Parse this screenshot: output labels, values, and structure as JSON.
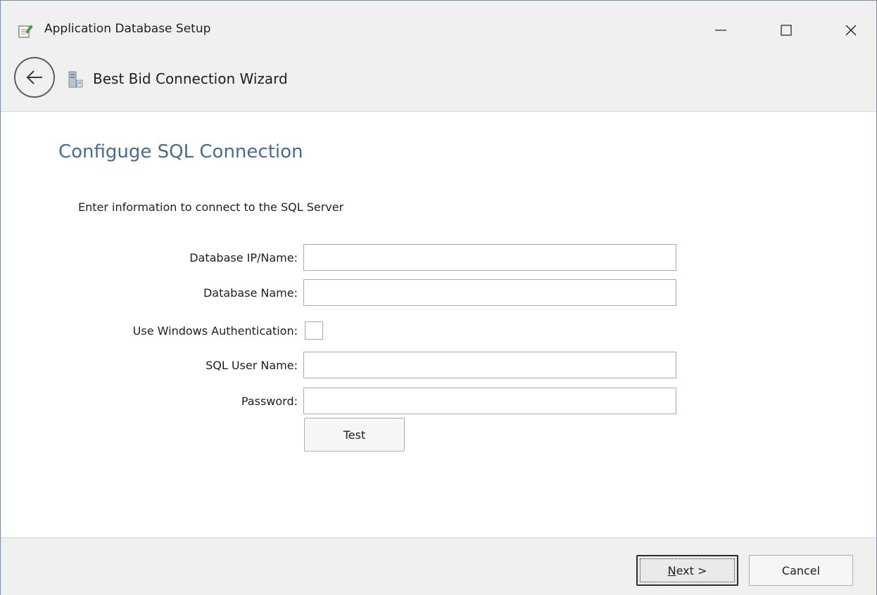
{
  "window": {
    "title": "Application Database Setup",
    "icons": {
      "app": "notepad-edit-icon",
      "minimize": "minimize-icon",
      "maximize": "maximize-icon",
      "close": "close-icon"
    }
  },
  "wizard": {
    "title": "Best Bid Connection Wizard",
    "back_icon": "back-arrow-icon",
    "wizard_icon": "database-server-icon"
  },
  "page": {
    "heading": "Configuge SQL Connection",
    "intro": "Enter information to connect to the SQL Server"
  },
  "form": {
    "database_ip": {
      "label": "Database IP/Name:",
      "value": ""
    },
    "database_name": {
      "label": "Database Name:",
      "value": ""
    },
    "windows_auth": {
      "label": "Use Windows Authentication:",
      "checked": false
    },
    "sql_user": {
      "label": "SQL User Name:",
      "value": ""
    },
    "password": {
      "label": "Password:",
      "value": ""
    },
    "test_label": "Test"
  },
  "footer": {
    "next_mnemonic": "N",
    "next_rest": "ext >",
    "cancel_label": "Cancel"
  },
  "colors": {
    "heading": "#4a6a8e",
    "chrome": "#f0f0f0",
    "border": "#a9a9a9"
  }
}
